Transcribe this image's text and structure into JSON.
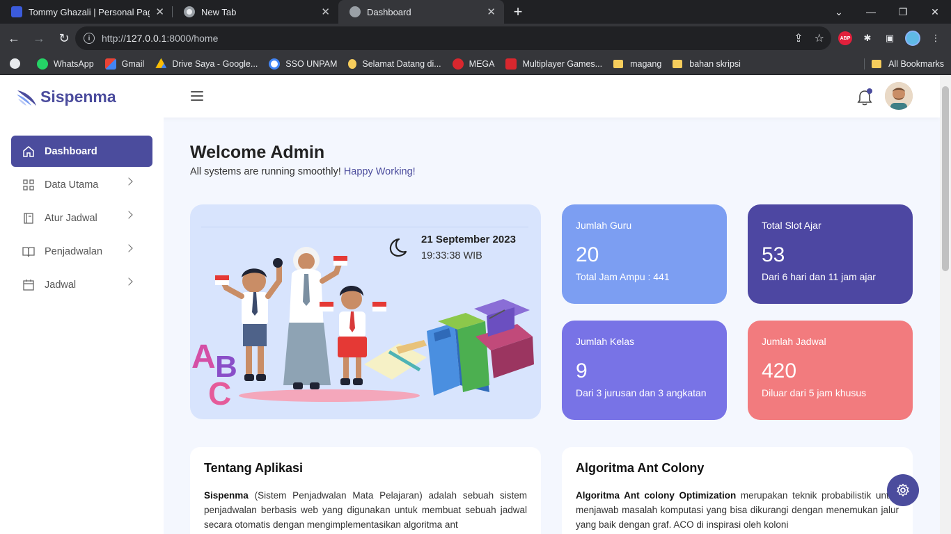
{
  "browser": {
    "tabs": [
      {
        "title": "Tommy Ghazali | Personal Pages",
        "icon": "portfolio-favicon"
      },
      {
        "title": "New Tab",
        "icon": "chrome-icon"
      },
      {
        "title": "Dashboard",
        "icon": "dashboard-favicon"
      }
    ],
    "active_tab": 2,
    "url_prefix": "http://",
    "url_host": "127.0.0.1",
    "url_rest": ":8000/home",
    "bookmarks": [
      {
        "label": "WhatsApp",
        "icon": "whatsapp-icon",
        "color": "#25d366"
      },
      {
        "label": "Gmail",
        "icon": "gmail-icon",
        "color": "#ea4335"
      },
      {
        "label": "Drive Saya - Google...",
        "icon": "drive-icon",
        "color": "#fbbc04"
      },
      {
        "label": "SSO UNPAM",
        "icon": "sso-icon",
        "color": "#4285f4"
      },
      {
        "label": "Selamat Datang di...",
        "icon": "selamat-icon",
        "color": "#f6cd5c"
      },
      {
        "label": "MEGA",
        "icon": "mega-icon",
        "color": "#d9272e"
      },
      {
        "label": "Multiplayer Games...",
        "icon": "games-icon",
        "color": "#d9272e"
      },
      {
        "label": "magang",
        "icon": "folder-icon",
        "color": "#f6cd5c"
      },
      {
        "label": "bahan skripsi",
        "icon": "folder-icon",
        "color": "#f6cd5c"
      }
    ],
    "all_bookmarks": "All Bookmarks"
  },
  "app": {
    "brand": "Sispenma",
    "accent": "#4b4c9d",
    "menu": [
      {
        "label": "Dashboard",
        "icon": "home-icon",
        "active": true
      },
      {
        "label": "Data Utama",
        "icon": "grid-icon"
      },
      {
        "label": "Atur Jadwal",
        "icon": "book-icon"
      },
      {
        "label": "Penjadwalan",
        "icon": "open-book-icon"
      },
      {
        "label": "Jadwal",
        "icon": "calendar-icon"
      }
    ]
  },
  "main": {
    "welcome": "Welcome Admin",
    "subtitle": "All systems are running smoothly!",
    "subtitle_highlight": "Happy Working!",
    "date": "21 September 2023",
    "time": "19:33:38 WIB",
    "cards": [
      {
        "label": "Jumlah Guru",
        "value": "20",
        "sub": "Total Jam Ampu : 441",
        "color": "#7c9ef2"
      },
      {
        "label": "Total Slot Ajar",
        "value": "53",
        "sub": "Dari 6 hari dan 11 jam ajar",
        "color": "#4d47a2"
      },
      {
        "label": "Jumlah Kelas",
        "value": "9",
        "sub": "Dari 3 jurusan dan 3 angkatan",
        "color": "#7873e6"
      },
      {
        "label": "Jumlah Jadwal",
        "value": "420",
        "sub": "Diluar dari 5 jam khusus",
        "color": "#f27b7e"
      }
    ],
    "panels": [
      {
        "title": "Tentang Aplikasi",
        "bold": "Sispenma",
        "text": " (Sistem Penjadwalan Mata Pelajaran) adalah sebuah sistem penjadwalan berbasis web yang digunakan untuk membuat sebuah jadwal secara otomatis dengan mengimplementasikan algoritma ant"
      },
      {
        "title": "Algoritma Ant Colony",
        "bold": "Algoritma Ant colony Optimization",
        "text": " merupakan teknik probabilistik untuk menjawab masalah komputasi yang bisa dikurangi dengan menemukan jalur yang baik dengan graf. ACO di inspirasi oleh koloni"
      }
    ]
  }
}
